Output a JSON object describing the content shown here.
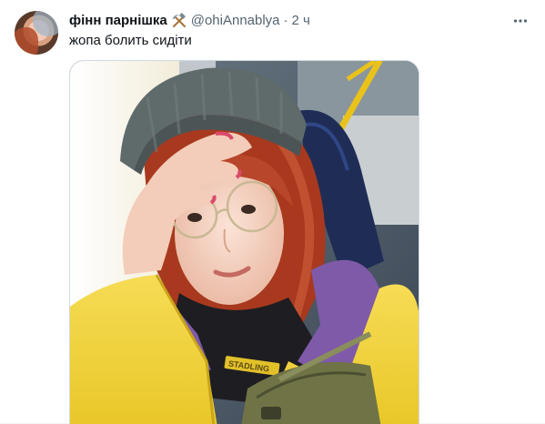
{
  "tweet": {
    "author": {
      "display_name": "фінн парнішка",
      "name_emoji_icon": "hammer-and-pick-icon",
      "handle": "@ohiAnnablya"
    },
    "separator": "·",
    "time": "2 ч",
    "text": "жопа болить сидіти",
    "more_icon": "more-horizontal-icon",
    "media": {
      "type": "photo",
      "visible_text_on_jacket": "STADLING"
    }
  },
  "colors": {
    "text_primary": "#0f1419",
    "text_secondary": "#536471",
    "border": "#cfd9de",
    "jacket_yellow": "#f1d33b",
    "hair_red": "#b8462a",
    "beanie_gray": "#5f6a6b",
    "hoodie_purple": "#7e5aa8",
    "bus_pole_yellow": "#e9c21a"
  }
}
